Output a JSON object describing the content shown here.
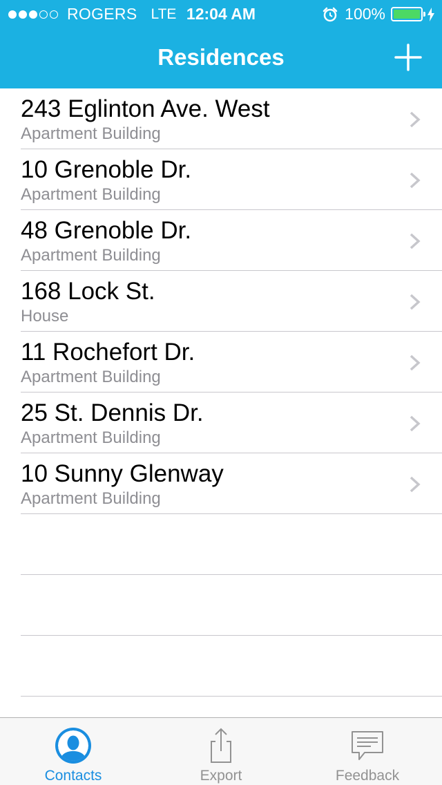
{
  "status_bar": {
    "carrier": "ROGERS",
    "network": "LTE",
    "time": "12:04 AM",
    "battery": "100%",
    "signal_bars_filled": 3,
    "signal_bars_total": 5
  },
  "nav": {
    "title": "Residences",
    "add_icon": "plus-icon"
  },
  "residences": [
    {
      "title": "243 Eglinton Ave. West",
      "subtitle": "Apartment Building"
    },
    {
      "title": "10 Grenoble Dr.",
      "subtitle": "Apartment Building"
    },
    {
      "title": "48 Grenoble Dr.",
      "subtitle": "Apartment Building"
    },
    {
      "title": "168 Lock St.",
      "subtitle": "House"
    },
    {
      "title": "11 Rochefort Dr.",
      "subtitle": "Apartment Building"
    },
    {
      "title": "25 St. Dennis Dr.",
      "subtitle": "Apartment Building"
    },
    {
      "title": "10 Sunny Glenway",
      "subtitle": "Apartment Building"
    }
  ],
  "tabs": [
    {
      "label": "Contacts",
      "icon": "contacts-icon",
      "active": true
    },
    {
      "label": "Export",
      "icon": "export-icon",
      "active": false
    },
    {
      "label": "Feedback",
      "icon": "feedback-icon",
      "active": false
    }
  ],
  "colors": {
    "header": "#1bb1e2",
    "active_tab": "#1a8ee0",
    "battery_fill": "#4cd964"
  }
}
